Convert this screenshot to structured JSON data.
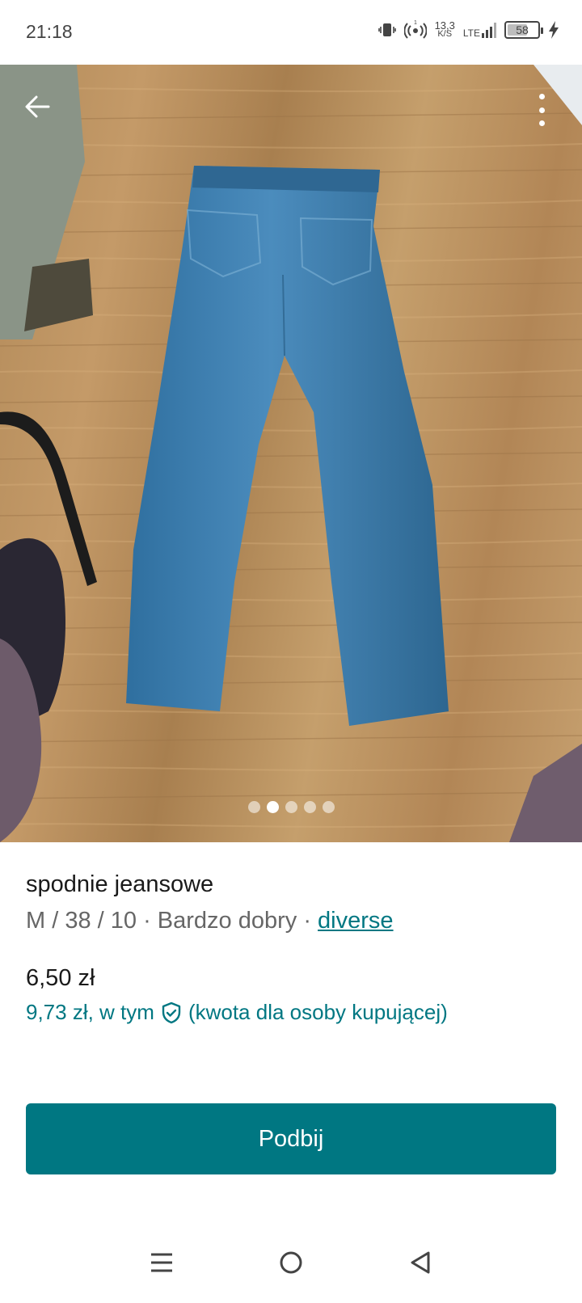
{
  "status_bar": {
    "time": "21:18",
    "speed_value": "13,3",
    "speed_unit": "K/S",
    "network": "LTE",
    "battery": "58"
  },
  "listing": {
    "title": "spodnie jeansowe",
    "size_and_condition": "M / 38 / 10 · Bardzo dobry · ",
    "brand": "diverse",
    "price": "6,50 zł",
    "total_price_prefix": "9,73 zł, w tym",
    "total_price_suffix": "(kwota dla osoby kupującej)",
    "photo_count": 5,
    "active_photo": 2
  },
  "actions": {
    "bump_label": "Podbij"
  },
  "colors": {
    "accent": "#007782",
    "text": "#1a1a1a",
    "muted": "#666666"
  },
  "icons": {
    "back": "arrow-left-icon",
    "more": "more-vertical-icon",
    "buyer_protection": "shield-check-icon",
    "nav_recent": "menu-icon",
    "nav_home": "circle-icon",
    "nav_back": "triangle-back-icon"
  }
}
